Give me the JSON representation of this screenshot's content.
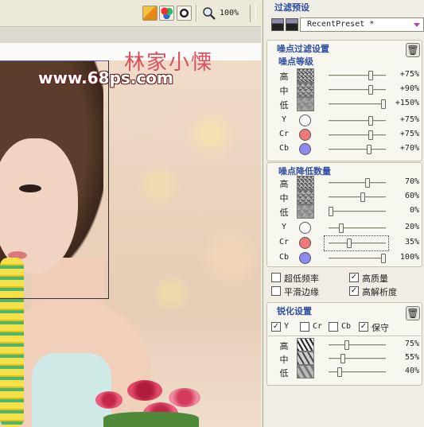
{
  "toolbar": {
    "zoom": "100%"
  },
  "image": {
    "watermark": "www.68ps.com",
    "title_text": "林家小慄"
  },
  "panel": {
    "filter_preset_title": "过滤预设",
    "preset_value": "RecentPreset *",
    "noise_filter_settings_title": "噪点过滤设置",
    "noise_level": {
      "title": "噪点等级",
      "rows": [
        {
          "label": "高",
          "value": "+75%",
          "level": 0.75
        },
        {
          "label": "中",
          "value": "+90%",
          "level": 0.76
        },
        {
          "label": "低",
          "value": "+150%",
          "level": 1.0
        }
      ],
      "color_rows": [
        {
          "label": "Y",
          "value": "+75%",
          "level": 0.75,
          "color": "#ffffff"
        },
        {
          "label": "Cr",
          "value": "+75%",
          "level": 0.75,
          "color": "#f07a7a"
        },
        {
          "label": "Cb",
          "value": "+70%",
          "level": 0.72,
          "color": "#8a8af0"
        }
      ]
    },
    "noise_reduction": {
      "title": "噪点降低数量",
      "rows": [
        {
          "label": "高",
          "value": "70%",
          "level": 0.7
        },
        {
          "label": "中",
          "value": "60%",
          "level": 0.6
        },
        {
          "label": "低",
          "value": "0%",
          "level": 0.0
        }
      ],
      "color_rows": [
        {
          "label": "Y",
          "value": "20%",
          "level": 0.2,
          "color": "#ffffff"
        },
        {
          "label": "Cr",
          "value": "35%",
          "level": 0.35,
          "color": "#f07a7a"
        },
        {
          "label": "Cb",
          "value": "100%",
          "level": 1.0,
          "color": "#8a8af0"
        }
      ]
    },
    "options": {
      "ultra_low_freq": {
        "label": "超低频率",
        "checked": false
      },
      "high_quality": {
        "label": "高质量",
        "checked": true
      },
      "smooth_edges": {
        "label": "平滑边缘",
        "checked": false
      },
      "high_resolution": {
        "label": "高解析度",
        "checked": true
      }
    },
    "sharpen": {
      "title": "锐化设置",
      "channels": {
        "y": {
          "label": "Y",
          "checked": true
        },
        "cr": {
          "label": "Cr",
          "checked": false
        },
        "cb": {
          "label": "Cb",
          "checked": false
        },
        "preserve": {
          "label": "保守",
          "checked": true
        }
      },
      "rows": [
        {
          "label": "高",
          "value": "75%",
          "level": 0.3
        },
        {
          "label": "中",
          "value": "55%",
          "level": 0.22
        },
        {
          "label": "低",
          "value": "40%",
          "level": 0.16
        }
      ]
    }
  }
}
